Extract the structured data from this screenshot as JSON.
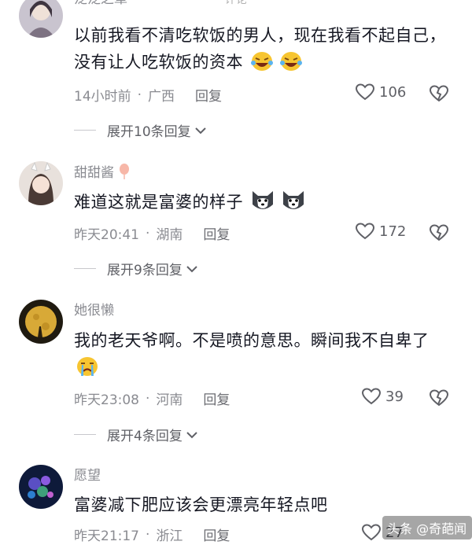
{
  "topbar": {
    "title": "评论"
  },
  "comments": [
    {
      "username": "泛泛之辈",
      "text": "以前我看不清吃软饭的男人，现在我看不起自己，没有让人吃软饭的资本",
      "time": "14小时前",
      "location": "广西",
      "reply": "回复",
      "likes": "106",
      "expand": "展开10条回复",
      "emoji": "rolling-laughing-emoji"
    },
    {
      "username": "甜甜酱",
      "text": "难道这就是富婆的样子",
      "time": "昨天20:41",
      "location": "湖南",
      "reply": "回复",
      "likes": "172",
      "expand": "展开9条回复",
      "emoji": "husky-emoji"
    },
    {
      "username": "她很懒",
      "text": "我的老天爷啊。不是喷的意思。瞬间我不自卑了",
      "time": "昨天23:08",
      "location": "河南",
      "reply": "回复",
      "likes": "39",
      "expand": "展开4条回复",
      "emoji": "crying-emoji"
    },
    {
      "username": "愿望",
      "text": "富婆减下肥应该会更漂亮年轻点吧",
      "time": "昨天21:17",
      "location": "浙江",
      "reply": "回复",
      "likes": "27"
    }
  ],
  "watermark": {
    "label": "头条 @奇葩闻"
  },
  "colors": {
    "text": "#161823",
    "secondary": "#8a8b91",
    "background": "#ffffff"
  }
}
